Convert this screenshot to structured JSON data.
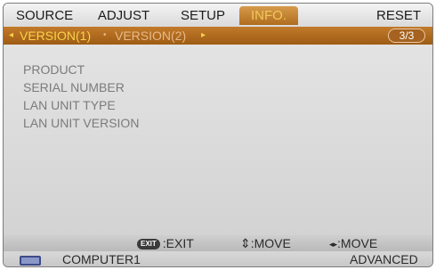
{
  "menu": {
    "tabs": [
      {
        "label": "SOURCE",
        "active": false
      },
      {
        "label": "ADJUST",
        "active": false
      },
      {
        "label": "SETUP",
        "active": false
      },
      {
        "label": "INFO.",
        "active": true
      },
      {
        "label": "RESET",
        "active": false
      }
    ]
  },
  "subtabs": {
    "left_arrow": "◂",
    "active_label": "VERSION(1)",
    "separator": "•",
    "inactive_label": "VERSION(2)",
    "right_arrow": "▸",
    "page_counter": "3/3"
  },
  "info": {
    "rows": [
      "PRODUCT",
      "SERIAL NUMBER",
      "LAN UNIT TYPE",
      "LAN UNIT VERSION"
    ]
  },
  "footer": {
    "exit_badge": "EXIT",
    "exit_label": ":EXIT",
    "move_updown_symbol": "⇕",
    "move_updown_label": ":MOVE",
    "move_leftright_symbol": "◂▸",
    "move_leftright_label": ":MOVE"
  },
  "status": {
    "source_icon": "computer-input-icon",
    "source_label": "COMPUTER1",
    "mode_label": "ADVANCED"
  },
  "colors": {
    "active_tab": "#b06d1f",
    "sub_bar": "#a9661e",
    "active_text": "#f7d34a",
    "content_bg": "#dcdcdc",
    "info_text": "#7b7b7b"
  }
}
